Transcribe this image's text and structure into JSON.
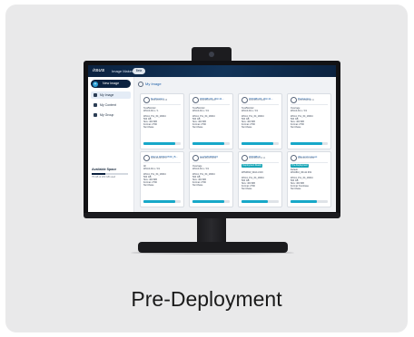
{
  "caption": "Pre-Deployment",
  "app": {
    "brand": "/ISUS",
    "title": "Image Maker",
    "badge": "Beta"
  },
  "sidebar": {
    "new_button": "New Image",
    "items": [
      {
        "label": "My Image",
        "active": true
      },
      {
        "label": "My Content",
        "active": false
      },
      {
        "label": "My Group",
        "active": false
      }
    ],
    "space": {
      "title": "Available Space",
      "detail": "75 GB of 200 GB used",
      "used_fraction": 0.375
    }
  },
  "main": {
    "title": "My Image",
    "tiles": [
      {
        "name": "Notification",
        "date": "2022-08-16 14:29",
        "tag": "",
        "lines": [
          "Test/Monitor",
          "Win10-D1.x / 1",
          "Win11_Pro_64_19044",
          "500 GB",
          "Size: 400 MB",
          "Format: 2790",
          "Num/base"
        ],
        "progress": 0.85
      },
      {
        "name": "WIN0810X_Win11...",
        "date": "2022-08-10 16:57",
        "tag": "",
        "lines": [
          "Test/Monitor",
          "Win10-D1.x / 19",
          "Win11_Pro_64_19044",
          "500 GB",
          "Size: 400 MB",
          "Format: 2790",
          "Num/base"
        ],
        "progress": 0.85
      },
      {
        "name": "WIN0810X_Win11...",
        "date": "2022-08-10 16:51",
        "tag": "",
        "lines": [
          "Test/Monitor",
          "Win10-D1.x / 19",
          "Win11_Pro_64_19044",
          "500 GB",
          "Size: 400 MB",
          "Format: 2790",
          "Num/base"
        ],
        "progress": 0.85
      },
      {
        "name": "Packaging",
        "date": "2022-08-08 18:11",
        "tag": "",
        "lines": [
          "Overrage",
          "Win10-D1.x / 19",
          "Win11_Pro_64_19044",
          "500 GB",
          "Size: 400 MB",
          "Format: 2790",
          "Num/base"
        ],
        "progress": 0.85
      },
      {
        "name": "Win11 DISM PDD_B...",
        "date": "2022-08-08 10:57",
        "tag": "",
        "lines": [
          "All",
          "Win10-D1.x / 19",
          "Win11_Pro_64_19044",
          "500 GB",
          "Size: 400 MB",
          "Format: 2790",
          "Num/base"
        ],
        "progress": 0.85
      },
      {
        "name": "test/WIN0810X",
        "date": "2022-08-03 19:01",
        "tag": "",
        "lines": [
          "Overrage",
          "Win10-D1.x / 19",
          "Win11_Pro_64_19044",
          "500 GB",
          "Size: 400 MB",
          "Format: 2790",
          "Num/base"
        ],
        "progress": 0.85
      },
      {
        "name": "WIN0810",
        "date": "2022-08-03 16:14",
        "tag": "Deployment Ready",
        "lines": [
          "",
          "WIN0810_Win11 #19",
          "Win11_Pro_64_19044",
          "500 GB",
          "Size: 400 MB",
          "Format: 2790",
          "Num/base"
        ],
        "progress": 0.7
      },
      {
        "name": "this.and.request",
        "date": "2022-08-01 13:53",
        "tag": "Pre-Deployment",
        "lines": [
          "Default",
          "Win0810_Win11 #19",
          "Win11_Pro_64_19044",
          "500 GB",
          "Size: 400 MB",
          "Format: Numbase",
          "Num/base"
        ],
        "progress": 0.7
      }
    ]
  }
}
